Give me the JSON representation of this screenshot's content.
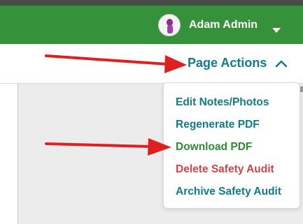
{
  "header": {
    "user_name": "Adam Admin",
    "avatar_icon": "user-avatar-icon",
    "caret_icon": "caret-down-icon"
  },
  "actions": {
    "label": "Page Actions",
    "toggle_icon": "chevron-up-icon",
    "menu": [
      {
        "label": "Edit Notes/Photos",
        "color": "#0f7c8a"
      },
      {
        "label": "Regenerate PDF",
        "color": "#0f7c8a"
      },
      {
        "label": "Download PDF",
        "color": "#2e8b34"
      },
      {
        "label": "Delete Safety Audit",
        "color": "#d04545"
      },
      {
        "label": "Archive Safety Audit",
        "color": "#0f7c8a"
      }
    ]
  },
  "colors": {
    "header_bg": "#35923a",
    "accent": "#0f7c8a",
    "arrow": "#e02020"
  }
}
